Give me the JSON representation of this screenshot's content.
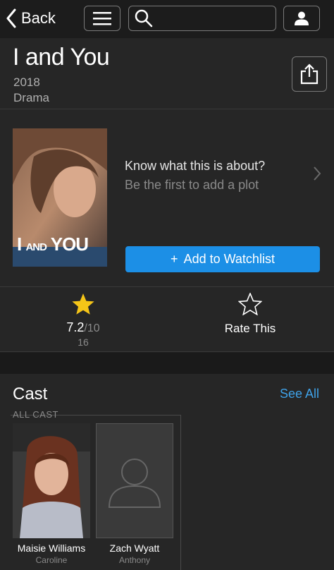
{
  "nav": {
    "back_label": "Back",
    "search_placeholder": "",
    "menu_icon": "hamburger-menu-icon",
    "user_icon": "user-icon"
  },
  "movie": {
    "title": "I and You",
    "year": "2018",
    "genre": "Drama",
    "poster_text_main": "I",
    "poster_text_and": "AND",
    "poster_text_you": "YOU"
  },
  "plot": {
    "question": "Know what this is about?",
    "prompt": "Be the first to add a plot"
  },
  "watchlist": {
    "label": "Add to Watchlist",
    "icon": "+"
  },
  "rating": {
    "value": "7.2",
    "max": "/10",
    "count": "16",
    "rate_label": "Rate This"
  },
  "cast": {
    "title": "Cast",
    "see_all": "See All",
    "section_label": "ALL CAST",
    "members": [
      {
        "name": "Maisie Williams",
        "role": "Caroline"
      },
      {
        "name": "Zach Wyatt",
        "role": "Anthony"
      }
    ]
  },
  "colors": {
    "accent": "#1c8fe6",
    "link": "#3fa2e8",
    "star": "#f5c518"
  }
}
